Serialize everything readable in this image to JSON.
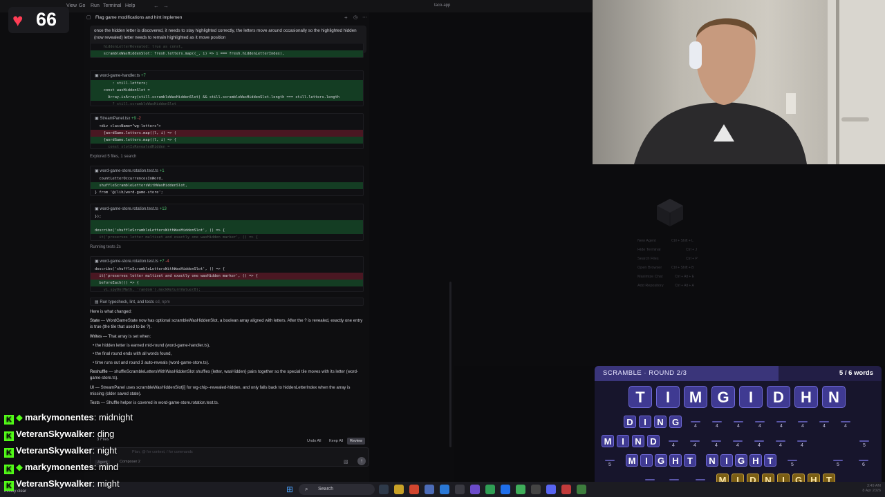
{
  "menubar": {
    "items": [
      "View",
      "Go",
      "Run",
      "Terminal",
      "Help"
    ],
    "title": "taco-app"
  },
  "heart": {
    "count": "66"
  },
  "chat": {
    "tab_title": "Flag game modifications and hint implemen",
    "user_message": "once the hidden letter is discovered, it needs to stay highlighted correctly, the letters move around occasionally so the highlighted hidden (now revealed) letter needs to remain highlighted as it move position",
    "block1": {
      "lines": [
        {
          "text": "    hiddenLetterRevealed: true as const,",
          "kind": "dim"
        },
        {
          "text": "    scrambleWasHiddenSlot: fresh.letters.map((_, i) => i === fresh.hiddenLetterIndex),",
          "kind": "plus"
        }
      ]
    },
    "block2": {
      "file": "word-game-handler.ts",
      "add": "+7",
      "del": "",
      "lines": [
        {
          "text": "        : still.letters;",
          "kind": "plus"
        },
        {
          "text": "    const wasHiddenSlot =",
          "kind": "plus"
        },
        {
          "text": "      Array.isArray(still.scrambleWasHiddenSlot) && still.scrambleWasHiddenSlot.length === still.letters.length",
          "kind": "plus"
        },
        {
          "text": "        ? still.scrambleWasHiddenSlot",
          "kind": "dim"
        }
      ]
    },
    "block3": {
      "file": "StreamPanel.tsx",
      "add": "+9",
      "del": "-2",
      "lines": [
        {
          "text": "  <div className=\"wg-letters\">",
          "kind": ""
        },
        {
          "text": "    {wordGame.letters.map((l, i) => (",
          "kind": "minus"
        },
        {
          "text": "    {wordGame.letters.map((l, i) => {",
          "kind": "plus"
        },
        {
          "text": "      const slotIsRevealedHidden =",
          "kind": "dim"
        }
      ]
    },
    "explored": "Explored 5 files, 1 search",
    "block4": {
      "file": "word-game-store.rotation.test.ts",
      "add": "+1",
      "del": "",
      "lines": [
        {
          "text": "  countLetterOccurrencesInWord,",
          "kind": ""
        },
        {
          "text": "  shuffleScrambleLettersWithWasHiddenSlot,",
          "kind": "plus"
        },
        {
          "text": "} from '@/lib/word-game-store';",
          "kind": ""
        }
      ]
    },
    "block5": {
      "file": "word-game-store.rotation.test.ts",
      "add": "+13",
      "del": "",
      "lines": [
        {
          "text": "});",
          "kind": ""
        },
        {
          "text": "",
          "kind": "plus"
        },
        {
          "text": "describe('shuffleScrambleLettersWithWasHiddenSlot', () => {",
          "kind": "plus"
        },
        {
          "text": "  it('preserves letter multiset and exactly one wasHidden marker', () => {",
          "kind": "dim"
        }
      ]
    },
    "running": "Running tests 2s",
    "block6": {
      "file": "word-game-store.rotation.test.ts",
      "add": "+7",
      "del": "-4",
      "lines": [
        {
          "text": "describe('shuffleScrambleLettersWithWasHiddenSlot', () => {",
          "kind": ""
        },
        {
          "text": "  it('preserves letter multiset and exactly one wasHidden marker', () => {",
          "kind": "minus"
        },
        {
          "text": "  beforeEach(() => {",
          "kind": "plus"
        },
        {
          "text": "    vi.spyOn(Math, 'random').mockReturnValue(0);",
          "kind": "dim"
        }
      ]
    },
    "run_cmd": "Run typecheck, lint, and tests",
    "run_cmd_note": "cd, npm",
    "summary_intro": "Here is what changed:",
    "state_label": "State",
    "state_text": "WordGameState now has optional scrambleWasHiddenSlot, a boolean array aligned with letters. After the ? is revealed, exactly one entry is true (the tile that used to be ?).",
    "writes_label": "Writes",
    "writes_text": "That array is set when:",
    "bullets": [
      "the hidden letter is earned mid-round (word-game-handler.ts),",
      "the final round ends with all words found,",
      "time runs out and round 3 auto-reveals (word-game-store.ts)."
    ],
    "reshuffle_label": "Reshuffle",
    "reshuffle_text": "shuffleScrambleLettersWithWasHiddenSlot shuffles {letter, wasHidden} pairs together so the special tile moves with its letter (word-game-store.ts).",
    "ui_label": "UI",
    "ui_text": "StreamPanel uses scrambleWasHiddenSlot[i] for wg-chip--revealed-hidden, and only falls back to hiddenLetterIndex when the array is missing (older saved state).",
    "tests_label": "Tests",
    "tests_text": "Shuffle helper is covered in word-game-store.rotation.test.ts.",
    "files_changed": "3 Files",
    "undo_all": "Undo All",
    "keep_all": "Keep All",
    "review": "Review",
    "agent_label": "Agent",
    "composer_label": "Composer 2",
    "input_placeholder": "Plan, @ for context, / for commands"
  },
  "stream_chat": [
    {
      "user": "markymonentes",
      "msg": "midnight",
      "diamond": true
    },
    {
      "user": "VeteranSkywalker",
      "msg": "ding",
      "diamond": false
    },
    {
      "user": "VeteranSkywalker",
      "msg": "night",
      "diamond": false
    },
    {
      "user": "markymonentes",
      "msg": "mind",
      "diamond": true
    },
    {
      "user": "VeteranSkywalker",
      "msg": "might",
      "diamond": false
    }
  ],
  "shortcuts": [
    {
      "label": "New Agent",
      "keys": "Ctrl + Shift + L"
    },
    {
      "label": "Hide Terminal",
      "keys": "Ctrl + J"
    },
    {
      "label": "Search Files",
      "keys": "Ctrl + P"
    },
    {
      "label": "Open Browser",
      "keys": "Ctrl + Shift + B"
    },
    {
      "label": "Maximize Chat",
      "keys": "Ctrl + Alt + E"
    },
    {
      "label": "Add Repository",
      "keys": "Ctrl + Alt + A"
    }
  ],
  "game": {
    "round": "SCRAMBLE · ROUND 2/3",
    "progress": "5 / 6 words",
    "progress_fraction": 0.64,
    "letters": [
      "T",
      "I",
      "M",
      "G",
      "I",
      "D",
      "H",
      "N"
    ],
    "found": [
      {
        "word": [
          "D",
          "I",
          "N",
          "G"
        ],
        "gold": false
      },
      {
        "word": [
          "M",
          "I",
          "N",
          "D"
        ],
        "gold": false
      },
      {
        "word": [
          "M",
          "I",
          "G",
          "H",
          "T"
        ],
        "gold": false
      },
      {
        "word": [
          "N",
          "I",
          "G",
          "H",
          "T"
        ],
        "gold": false
      },
      {
        "word": [
          "M",
          "I",
          "D",
          "N",
          "I",
          "G",
          "H",
          "T"
        ],
        "gold": true
      }
    ],
    "slot_row1": [
      "4",
      "4",
      "4",
      "4",
      "4",
      "4",
      "4",
      "4"
    ],
    "slot_row2": [
      "4",
      "4",
      "4",
      "4",
      "4",
      "4",
      "4",
      "5"
    ],
    "slot_row3_left": [
      "5"
    ],
    "slot_row3_right": [
      "5",
      "5",
      "6"
    ],
    "slot_row4": [
      "6",
      "6",
      "6"
    ]
  },
  "taskbar": {
    "weather": "Mostly clear",
    "search": "Search",
    "clock_time": "3:49 AM",
    "clock_date": "8 Apr 2026"
  },
  "colors": {
    "accent_tile": "#3f3a92",
    "gold_tile": "#7a5d14",
    "kick_green": "#53fc18",
    "heart": "#ff3d55"
  }
}
